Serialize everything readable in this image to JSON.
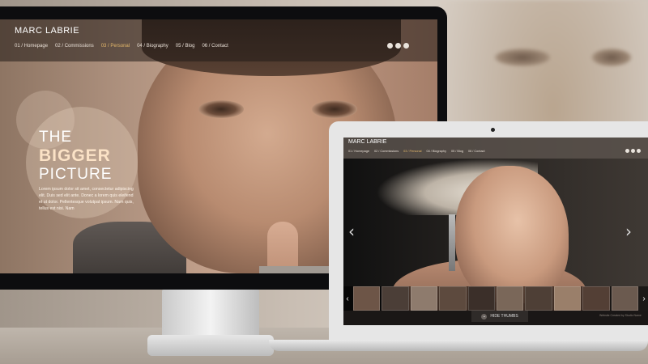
{
  "monitor": {
    "logo": "MARC LABRIE",
    "nav": [
      "01 / Homepage",
      "02 / Commissions",
      "03 / Personal",
      "04 / Biography",
      "05 / Blog",
      "06 / Contact"
    ],
    "active_nav": "03 / Personal",
    "hero": {
      "line1": "THE",
      "line2": "BIGGER",
      "line3": "PICTURE",
      "body": "Lorem ipsum dolor sit amet, consectetur adipiscing elit. Duis sed elit ante. Donec a lorem quis eleifend et ut dolor. Pellentesque volutpat ipsum. Nam quis, tellus est nisi. Nam"
    },
    "social_icons": [
      "social-icon",
      "social-icon",
      "social-icon"
    ]
  },
  "laptop": {
    "logo": "MARC LABRIE",
    "nav": [
      "01 / Homepage",
      "02 / Commissions",
      "03 / Personal",
      "04 / Biography",
      "05 / Blog",
      "06 / Contact"
    ],
    "active_nav": "03 / Personal",
    "prev_arrow": "‹",
    "next_arrow": "›",
    "thumb_prev": "‹",
    "thumb_next": "›",
    "thumbnails": [
      {
        "color": "#6d5547"
      },
      {
        "color": "#4b3e37"
      },
      {
        "color": "#8e7b6d"
      },
      {
        "color": "#5d4a3e"
      },
      {
        "color": "#3b2f29"
      },
      {
        "color": "#7a6759"
      },
      {
        "color": "#4e3f36"
      },
      {
        "color": "#9a7f6a"
      },
      {
        "color": "#533f35"
      },
      {
        "color": "#6b5a4f"
      }
    ],
    "hide_thumbs_label": "HIDE THUMBS",
    "hide_thumbs_icon": "⌄",
    "credit": "Website Created by Studio Name"
  },
  "colors": {
    "accent_active": "#e3b76a",
    "hero_highlight": "#fbe2c6"
  }
}
